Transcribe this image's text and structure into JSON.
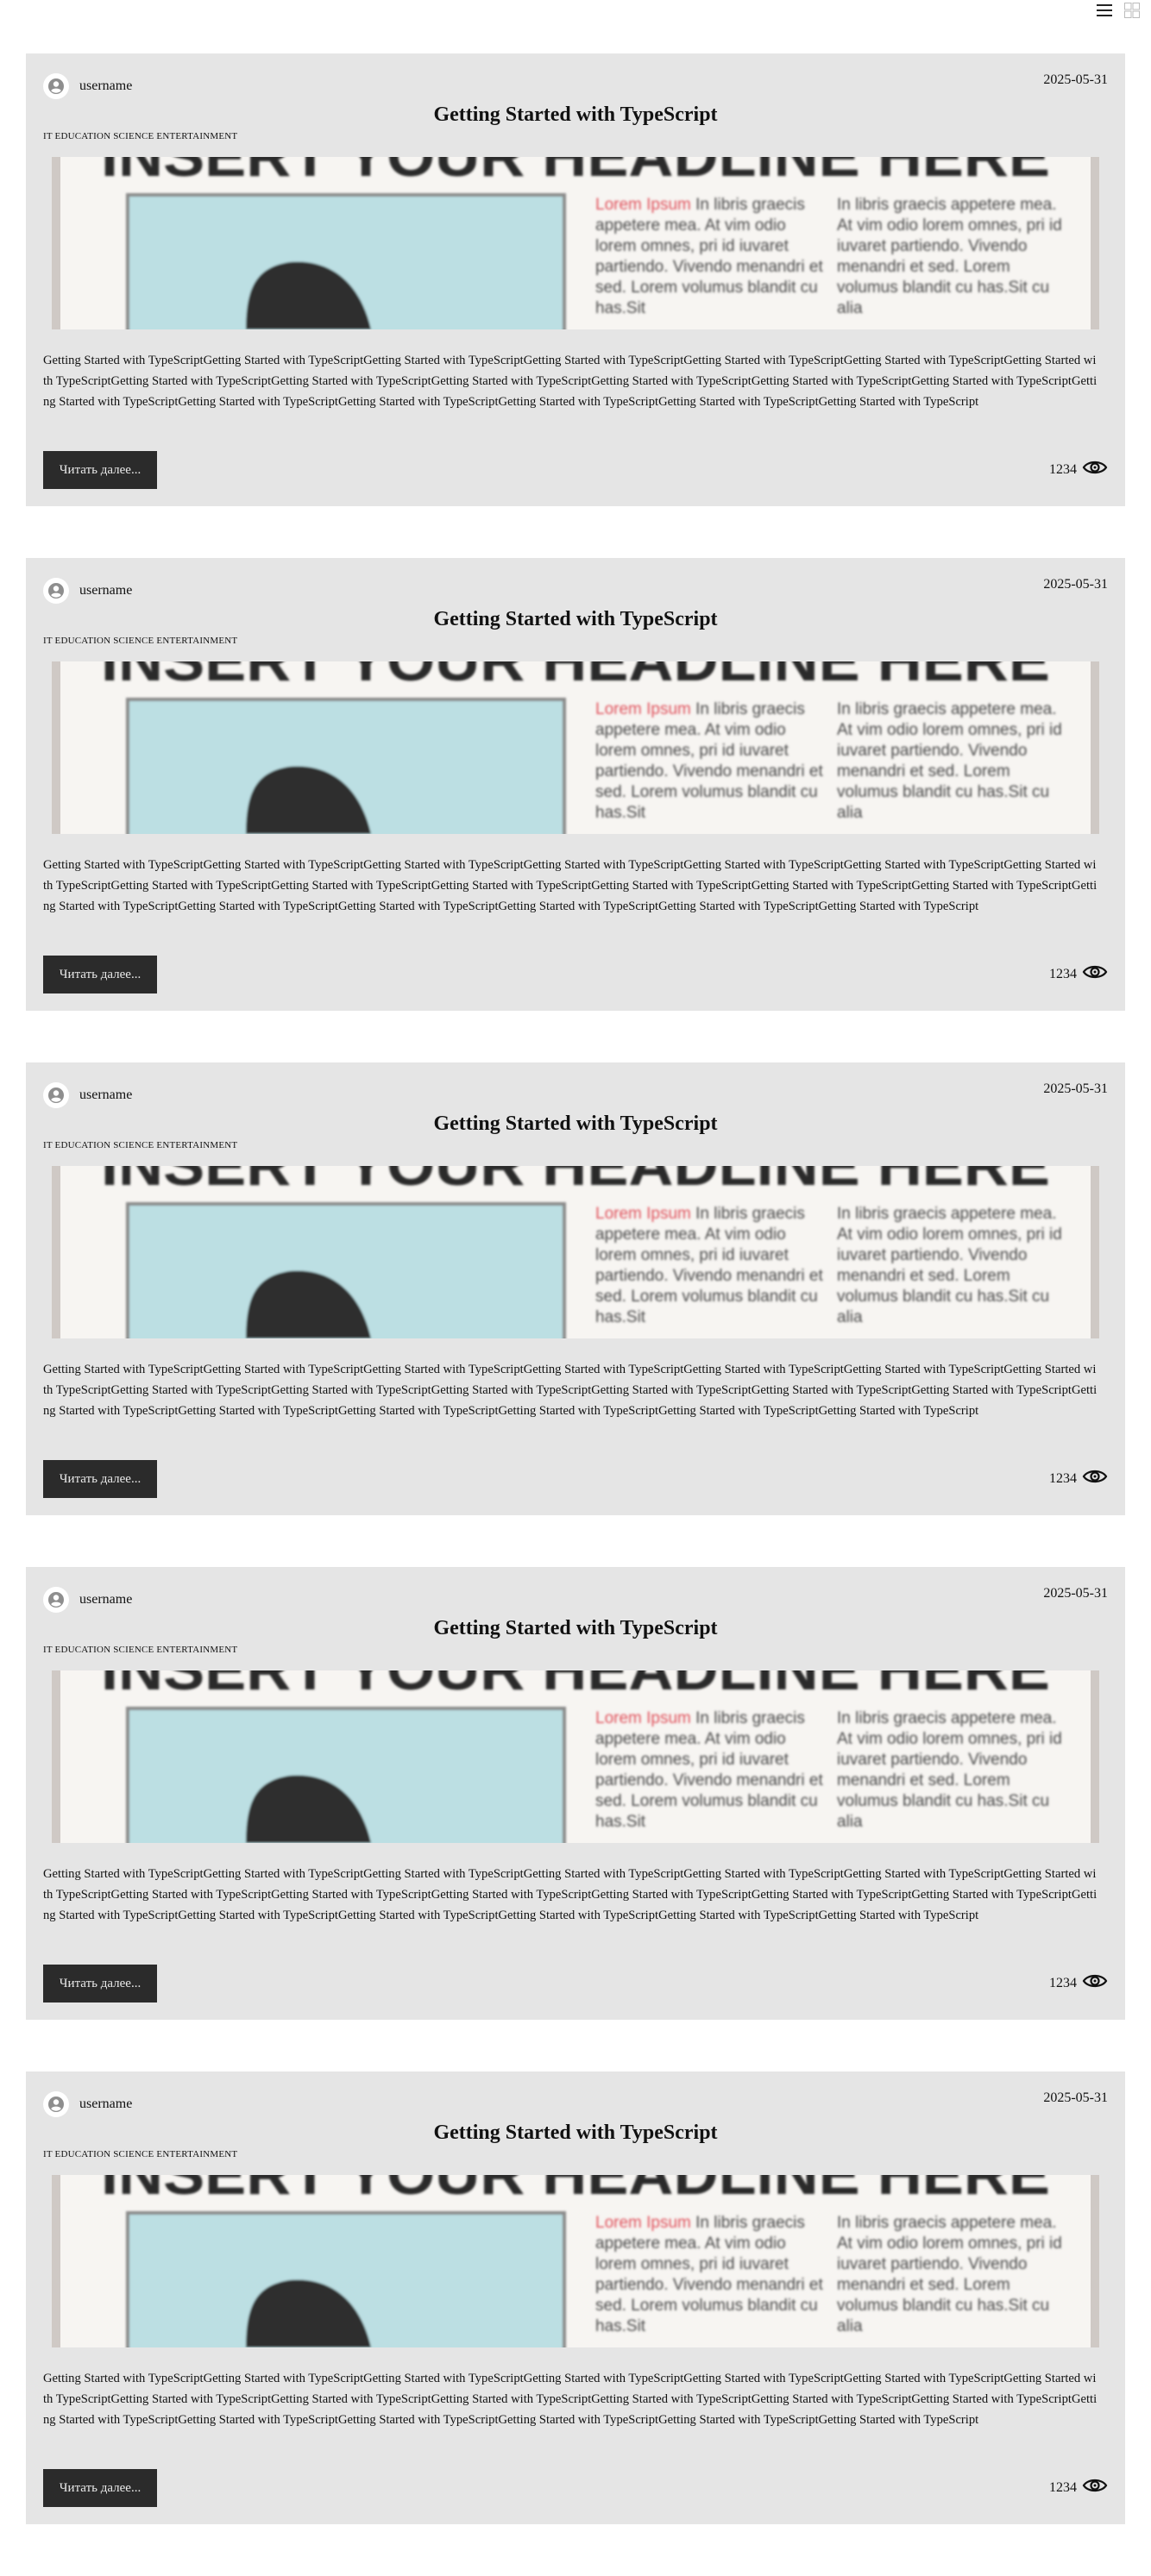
{
  "toolbar": {
    "list_view_icon": "list-icon",
    "grid_view_icon": "grid-icon"
  },
  "posts": [
    {
      "username": "username",
      "date": "2025-05-31",
      "title": "Getting Started with TypeScript",
      "tags": "IT EDUCATION SCIENCE ENTERTAINMENT",
      "thumbnail_headline": "INSERT YOUR HEADLINE HERE",
      "thumbnail_col1_accent": "Lorem Ipsum",
      "thumbnail_col1_text": " In libris graecis appetere mea. At vim odio lorem omnes, pri id iuvaret partiendo. Vivendo menandri et sed. Lorem volumus blandit cu has.Sit",
      "thumbnail_col2_text": "In libris graecis appetere mea. At vim odio lorem omnes, pri id iuvaret partiendo. Vivendo menandri et sed. Lorem volumus blandit cu has.Sit cu alia",
      "excerpt": "Getting Started with TypeScriptGetting Started with TypeScriptGetting Started with TypeScriptGetting Started with TypeScriptGetting Started with TypeScriptGetting Started with TypeScriptGetting Started with TypeScriptGetting Started with TypeScriptGetting Started with TypeScriptGetting Started with TypeScriptGetting Started with TypeScriptGetting Started with TypeScriptGetting Started with TypeScriptGetting Started with TypeScriptGetting Started with TypeScriptGetting Started with TypeScriptGetting Started with TypeScriptGetting Started with TypeScriptGetting Started with TypeScript",
      "read_more_label": "Читать далее...",
      "views": "1234"
    },
    {
      "username": "username",
      "date": "2025-05-31",
      "title": "Getting Started with TypeScript",
      "tags": "IT EDUCATION SCIENCE ENTERTAINMENT",
      "thumbnail_headline": "INSERT YOUR HEADLINE HERE",
      "thumbnail_col1_accent": "Lorem Ipsum",
      "thumbnail_col1_text": " In libris graecis appetere mea. At vim odio lorem omnes, pri id iuvaret partiendo. Vivendo menandri et sed. Lorem volumus blandit cu has.Sit",
      "thumbnail_col2_text": "In libris graecis appetere mea. At vim odio lorem omnes, pri id iuvaret partiendo. Vivendo menandri et sed. Lorem volumus blandit cu has.Sit cu alia",
      "excerpt": "Getting Started with TypeScriptGetting Started with TypeScriptGetting Started with TypeScriptGetting Started with TypeScriptGetting Started with TypeScriptGetting Started with TypeScriptGetting Started with TypeScriptGetting Started with TypeScriptGetting Started with TypeScriptGetting Started with TypeScriptGetting Started with TypeScriptGetting Started with TypeScriptGetting Started with TypeScriptGetting Started with TypeScriptGetting Started with TypeScriptGetting Started with TypeScriptGetting Started with TypeScriptGetting Started with TypeScriptGetting Started with TypeScript",
      "read_more_label": "Читать далее...",
      "views": "1234"
    },
    {
      "username": "username",
      "date": "2025-05-31",
      "title": "Getting Started with TypeScript",
      "tags": "IT EDUCATION SCIENCE ENTERTAINMENT",
      "thumbnail_headline": "INSERT YOUR HEADLINE HERE",
      "thumbnail_col1_accent": "Lorem Ipsum",
      "thumbnail_col1_text": " In libris graecis appetere mea. At vim odio lorem omnes, pri id iuvaret partiendo. Vivendo menandri et sed. Lorem volumus blandit cu has.Sit",
      "thumbnail_col2_text": "In libris graecis appetere mea. At vim odio lorem omnes, pri id iuvaret partiendo. Vivendo menandri et sed. Lorem volumus blandit cu has.Sit cu alia",
      "excerpt": "Getting Started with TypeScriptGetting Started with TypeScriptGetting Started with TypeScriptGetting Started with TypeScriptGetting Started with TypeScriptGetting Started with TypeScriptGetting Started with TypeScriptGetting Started with TypeScriptGetting Started with TypeScriptGetting Started with TypeScriptGetting Started with TypeScriptGetting Started with TypeScriptGetting Started with TypeScriptGetting Started with TypeScriptGetting Started with TypeScriptGetting Started with TypeScriptGetting Started with TypeScriptGetting Started with TypeScriptGetting Started with TypeScript",
      "read_more_label": "Читать далее...",
      "views": "1234"
    },
    {
      "username": "username",
      "date": "2025-05-31",
      "title": "Getting Started with TypeScript",
      "tags": "IT EDUCATION SCIENCE ENTERTAINMENT",
      "thumbnail_headline": "INSERT YOUR HEADLINE HERE",
      "thumbnail_col1_accent": "Lorem Ipsum",
      "thumbnail_col1_text": " In libris graecis appetere mea. At vim odio lorem omnes, pri id iuvaret partiendo. Vivendo menandri et sed. Lorem volumus blandit cu has.Sit",
      "thumbnail_col2_text": "In libris graecis appetere mea. At vim odio lorem omnes, pri id iuvaret partiendo. Vivendo menandri et sed. Lorem volumus blandit cu has.Sit cu alia",
      "excerpt": "Getting Started with TypeScriptGetting Started with TypeScriptGetting Started with TypeScriptGetting Started with TypeScriptGetting Started with TypeScriptGetting Started with TypeScriptGetting Started with TypeScriptGetting Started with TypeScriptGetting Started with TypeScriptGetting Started with TypeScriptGetting Started with TypeScriptGetting Started with TypeScriptGetting Started with TypeScriptGetting Started with TypeScriptGetting Started with TypeScriptGetting Started with TypeScriptGetting Started with TypeScriptGetting Started with TypeScriptGetting Started with TypeScript",
      "read_more_label": "Читать далее...",
      "views": "1234"
    },
    {
      "username": "username",
      "date": "2025-05-31",
      "title": "Getting Started with TypeScript",
      "tags": "IT EDUCATION SCIENCE ENTERTAINMENT",
      "thumbnail_headline": "INSERT YOUR HEADLINE HERE",
      "thumbnail_col1_accent": "Lorem Ipsum",
      "thumbnail_col1_text": " In libris graecis appetere mea. At vim odio lorem omnes, pri id iuvaret partiendo. Vivendo menandri et sed. Lorem volumus blandit cu has.Sit",
      "thumbnail_col2_text": "In libris graecis appetere mea. At vim odio lorem omnes, pri id iuvaret partiendo. Vivendo menandri et sed. Lorem volumus blandit cu has.Sit cu alia",
      "excerpt": "Getting Started with TypeScriptGetting Started with TypeScriptGetting Started with TypeScriptGetting Started with TypeScriptGetting Started with TypeScriptGetting Started with TypeScriptGetting Started with TypeScriptGetting Started with TypeScriptGetting Started with TypeScriptGetting Started with TypeScriptGetting Started with TypeScriptGetting Started with TypeScriptGetting Started with TypeScriptGetting Started with TypeScriptGetting Started with TypeScriptGetting Started with TypeScriptGetting Started with TypeScriptGetting Started with TypeScriptGetting Started with TypeScript",
      "read_more_label": "Читать далее...",
      "views": "1234"
    }
  ],
  "colors": {
    "card_background": "#e5e5e5",
    "button_background": "#2b2b2b",
    "thumbnail_accent_red": "#e0525d",
    "thumbnail_panel_blue": "#bcdfe3"
  }
}
